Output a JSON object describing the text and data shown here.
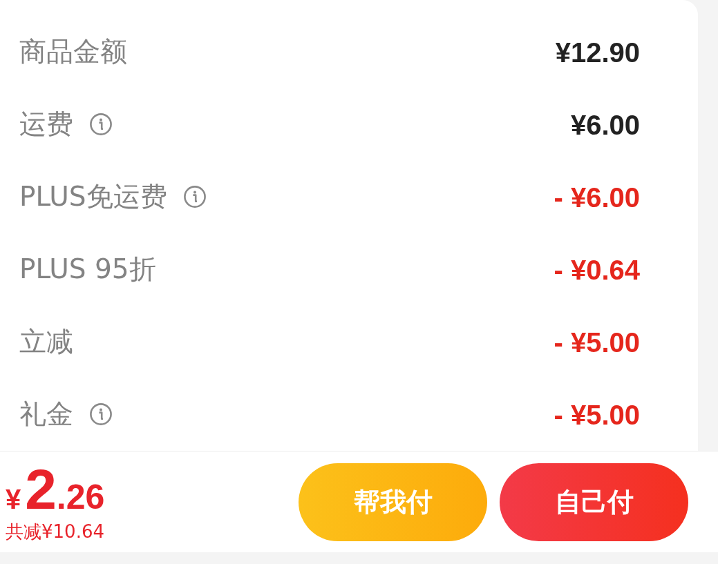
{
  "fee_rows": [
    {
      "label": "商品金额",
      "info": false,
      "kind": "charge",
      "amount": "¥12.90"
    },
    {
      "label": "运费",
      "info": true,
      "kind": "charge",
      "amount": "¥6.00"
    },
    {
      "label": "PLUS免运费",
      "info": true,
      "kind": "deduction",
      "amount": "- ¥6.00"
    },
    {
      "label": "PLUS 95折",
      "info": false,
      "kind": "deduction",
      "amount": "- ¥0.64"
    },
    {
      "label": "立减",
      "info": false,
      "kind": "deduction",
      "amount": "- ¥5.00"
    },
    {
      "label": "礼金",
      "info": true,
      "kind": "deduction",
      "amount": "- ¥5.00"
    }
  ],
  "footer": {
    "total": {
      "currency": "¥",
      "integer": "2",
      "fraction": ".26"
    },
    "saving": "共减¥10.64",
    "buttons": [
      {
        "label": "帮我付",
        "kind": "secondary"
      },
      {
        "label": "自己付",
        "kind": "primary"
      }
    ]
  }
}
